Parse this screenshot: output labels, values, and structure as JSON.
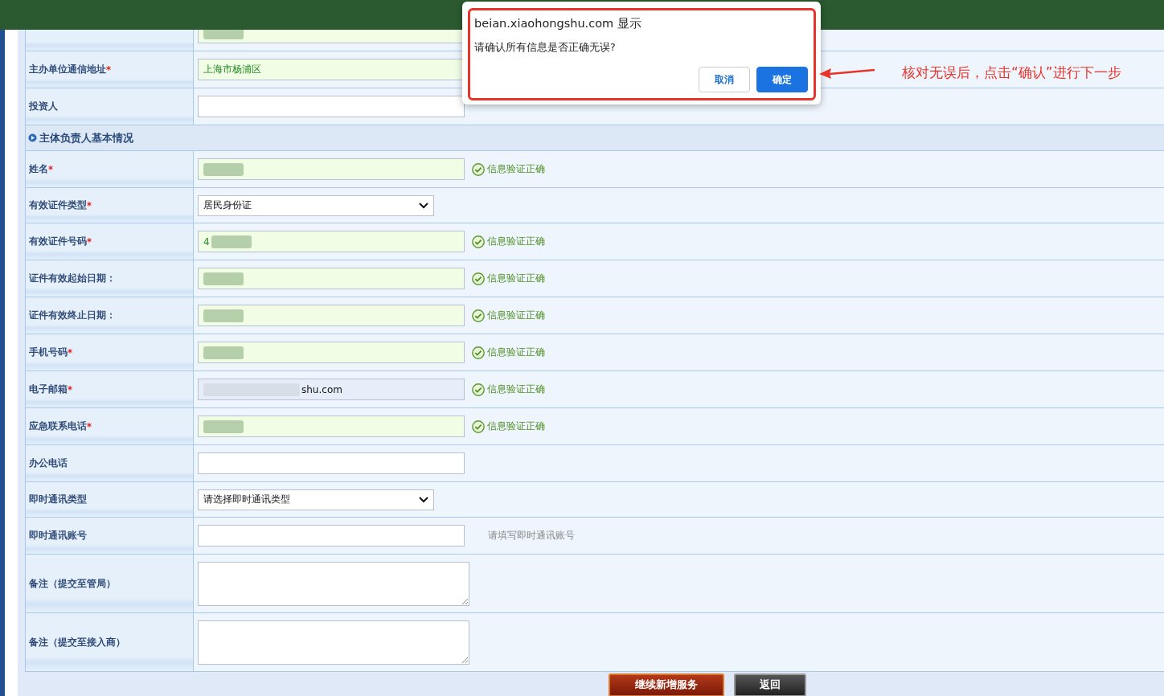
{
  "top_rows": [
    {
      "kind": "text",
      "redacted": true,
      "filled": true
    },
    {
      "label": "主办单位通信地址",
      "marker": "*",
      "kind": "text",
      "value": "上海市杨浦区",
      "filled": true
    },
    {
      "label": "投资人",
      "kind": "text",
      "filled": false
    }
  ],
  "section": {
    "title": "主体负责人基本情况",
    "rows": [
      {
        "label": "姓名",
        "marker": "*",
        "kind": "text",
        "redacted": true,
        "filled": true,
        "status": "信息验证正确"
      },
      {
        "label": "有效证件类型",
        "marker": "*",
        "kind": "select",
        "value": "居民身份证"
      },
      {
        "label": "有效证件号码",
        "marker": "*",
        "kind": "text",
        "value": "4",
        "redacted": true,
        "filled": true,
        "status": "信息验证正确"
      },
      {
        "label": "证件有效起始日期：",
        "kind": "text",
        "redacted": true,
        "filled": true,
        "status": "信息验证正确"
      },
      {
        "label": "证件有效终止日期：",
        "kind": "text",
        "redacted": true,
        "filled": true,
        "status": "信息验证正确"
      },
      {
        "label": "手机号码",
        "marker": "*",
        "kind": "text",
        "redacted": true,
        "filled": true,
        "status": "信息验证正确"
      },
      {
        "label": "电子邮箱",
        "marker": "*",
        "kind": "text",
        "value": "shu.com",
        "redacted": true,
        "autofill": true,
        "status": "信息验证正确"
      },
      {
        "label": "应急联系电话",
        "marker": "*",
        "kind": "text",
        "redacted": true,
        "filled": true,
        "status": "信息验证正确"
      },
      {
        "label": "办公电话",
        "kind": "text",
        "filled": false
      },
      {
        "label": "即时通讯类型",
        "kind": "select",
        "value": "请选择即时通讯类型"
      },
      {
        "label": "即时通讯账号",
        "kind": "text",
        "filled": false,
        "hint": "请填写即时通讯账号"
      },
      {
        "label": "备注（提交至管局）",
        "kind": "textarea"
      },
      {
        "label": "备注（提交至接入商）",
        "kind": "textarea"
      }
    ]
  },
  "buttons": [
    {
      "label": "继续新增服务",
      "kind": "primary"
    },
    {
      "label": "返回",
      "kind": "secondary"
    }
  ],
  "dialog": {
    "title": "beian.xiaohongshu.com 显示",
    "message": "请确认所有信息是否正确无误?",
    "buttons": [
      {
        "label": "取消",
        "kind": "secondary"
      },
      {
        "label": "确定",
        "kind": "primary"
      }
    ]
  },
  "annotation": {
    "text": "核对无误后，点击“确认”进行下一步"
  }
}
